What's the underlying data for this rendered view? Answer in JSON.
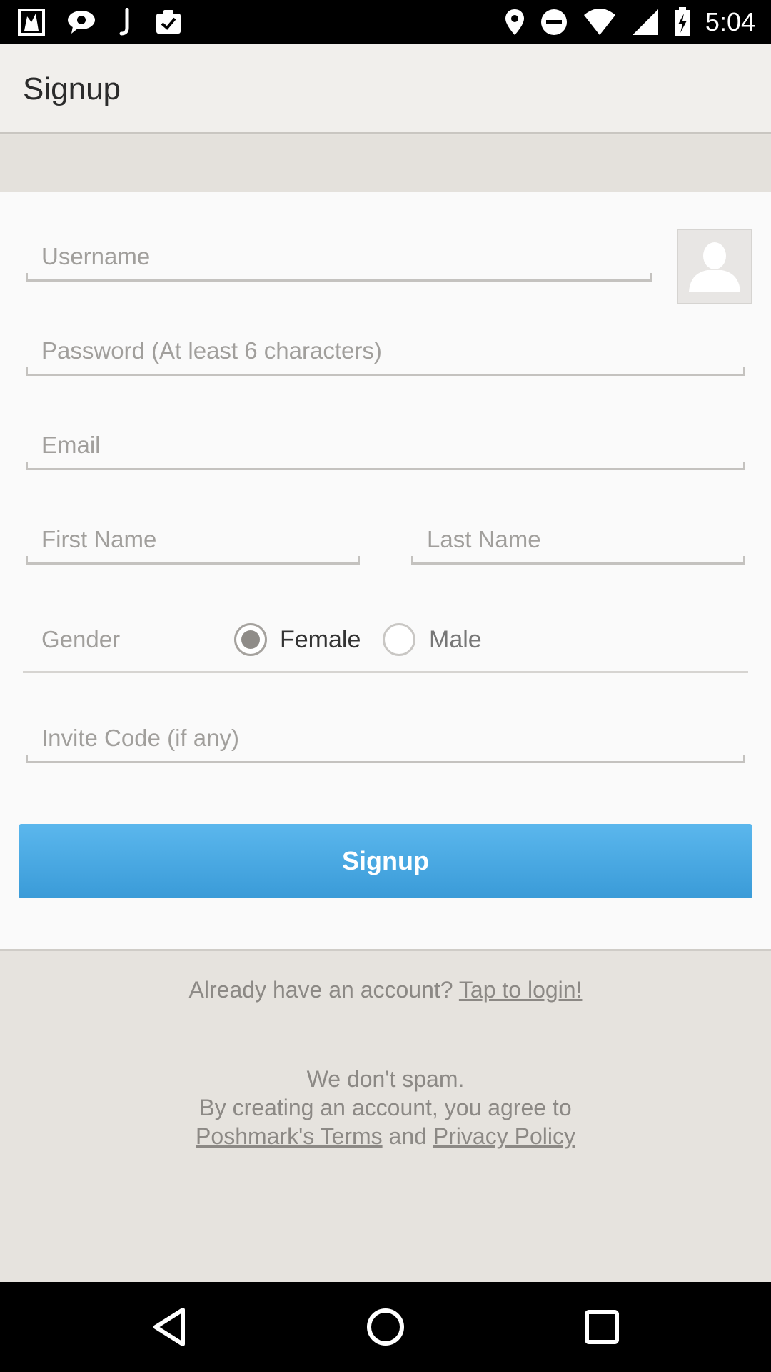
{
  "status_bar": {
    "time": "5:04",
    "left_icons": [
      "image-icon",
      "speech-bubble-icon",
      "j-app-icon",
      "clipboard-check-icon"
    ],
    "right_icons": [
      "location-pin-icon",
      "do-not-disturb-icon",
      "wifi-icon",
      "cell-signal-icon",
      "battery-charging-icon"
    ]
  },
  "toolbar": {
    "title": "Signup"
  },
  "form": {
    "username_placeholder": "Username",
    "password_placeholder": "Password (At least 6 characters)",
    "email_placeholder": "Email",
    "first_name_placeholder": "First Name",
    "last_name_placeholder": "Last Name",
    "gender_label": "Gender",
    "gender_options": [
      {
        "label": "Female",
        "checked": true
      },
      {
        "label": "Male",
        "checked": false
      }
    ],
    "invite_placeholder": "Invite Code (if any)",
    "signup_label": "Signup",
    "avatar_icon": "person-icon"
  },
  "footer": {
    "login_prompt": "Already have an account?",
    "login_link": "Tap to login!",
    "no_spam": "We don't spam.",
    "agree_text": "By creating an account, you agree to",
    "terms_link": "Poshmark's Terms",
    "and_text": "and",
    "privacy_link": "Privacy Policy"
  },
  "colors": {
    "accent": "#3a9bd8",
    "accent_light": "#5bb7ed",
    "background": "#e6e3de",
    "card": "#fafafa"
  }
}
